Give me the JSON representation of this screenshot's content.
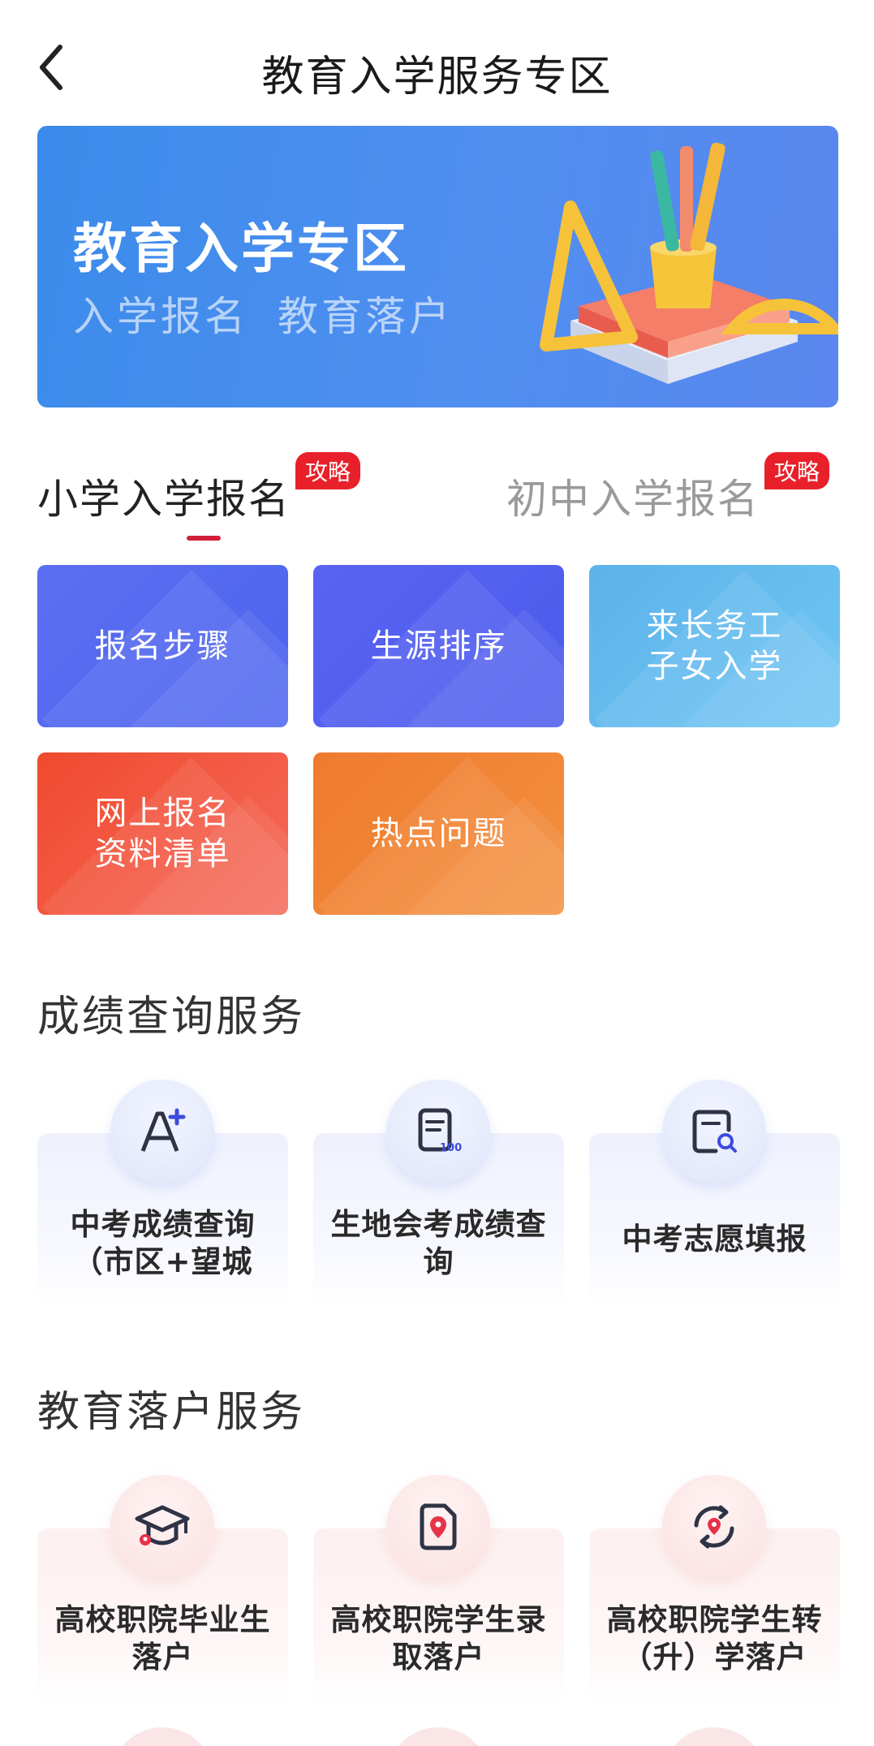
{
  "header": {
    "title": "教育入学服务专区"
  },
  "banner": {
    "title": "教育入学专区",
    "subtitles": [
      "入学报名",
      "教育落户"
    ]
  },
  "tabs": [
    {
      "label": "小学入学报名",
      "badge": "攻略",
      "active": true
    },
    {
      "label": "初中入学报名",
      "badge": "攻略",
      "active": false
    }
  ],
  "tiles": [
    {
      "label": "报名步骤"
    },
    {
      "label": "生源排序"
    },
    {
      "label": "来长务工\n子女入学"
    },
    {
      "label": "网上报名\n资料清单"
    },
    {
      "label": "热点问题"
    }
  ],
  "score_section": {
    "title": "成绩查询服务",
    "items": [
      {
        "label": "中考成绩查询（市区+望城",
        "icon": "a-plus-icon"
      },
      {
        "label": "生地会考成绩查询",
        "icon": "score-100-icon"
      },
      {
        "label": "中考志愿填报",
        "icon": "document-search-icon"
      }
    ]
  },
  "settle_section": {
    "title": "教育落户服务",
    "items": [
      {
        "label": "高校职院毕业生落户",
        "icon": "graduation-cap-icon"
      },
      {
        "label": "高校职院学生录取落户",
        "icon": "document-location-icon"
      },
      {
        "label": "高校职院学生转（升）学落户",
        "icon": "location-transfer-icon"
      }
    ]
  },
  "colors": {
    "accent": "#d3203a",
    "badge": "#e8202a",
    "banner": "#4a8ef0"
  }
}
